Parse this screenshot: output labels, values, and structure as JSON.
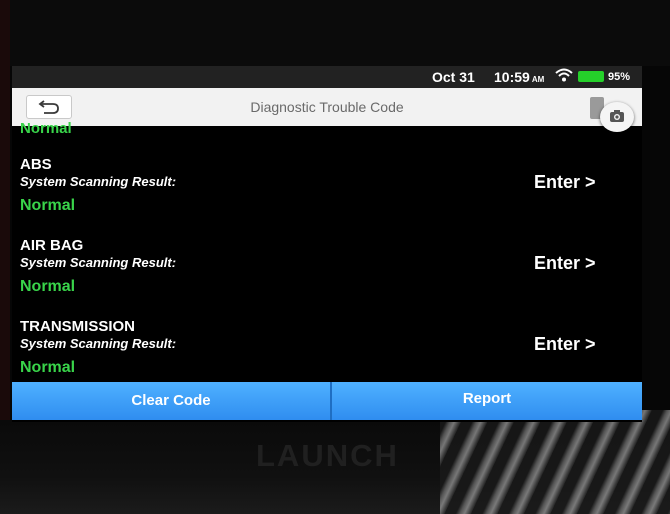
{
  "device": {
    "brand": "LAUNCH"
  },
  "status_bar": {
    "date": "Oct 31",
    "time": "10:59",
    "ampm": "AM",
    "battery": "95%",
    "battery_level": 0.95
  },
  "header": {
    "title": "Diagnostic Trouble Code"
  },
  "colors": {
    "ok": "#39d44a",
    "accent": "#3a9cf7",
    "background": "#000000"
  },
  "list": {
    "previous_status": "Normal",
    "items": [
      {
        "system": "ABS",
        "result_label": "System Scanning Result:",
        "status": "Normal",
        "action": "Enter >"
      },
      {
        "system": "AIR BAG",
        "result_label": "System Scanning Result:",
        "status": "Normal",
        "action": "Enter >"
      },
      {
        "system": "TRANSMISSION",
        "result_label": "System Scanning Result:",
        "status": "Normal",
        "action": "Enter >"
      }
    ]
  },
  "footer": {
    "clear_label": "Clear Code",
    "report_label": "Report"
  }
}
